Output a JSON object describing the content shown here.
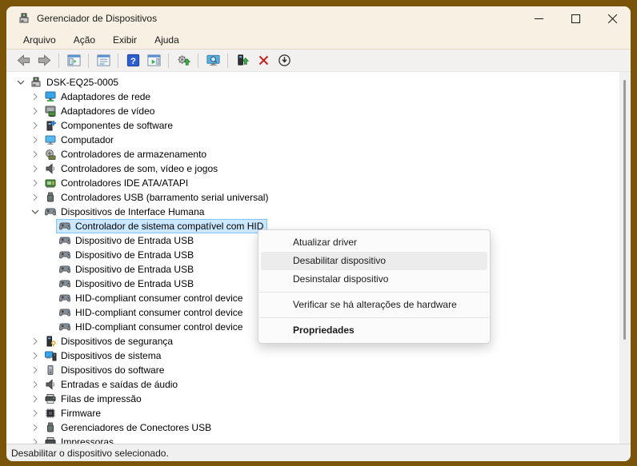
{
  "window": {
    "title": "Gerenciador de Dispositivos",
    "controls": {
      "minimize": "minimize",
      "maximize": "maximize",
      "close": "close"
    }
  },
  "menubar": {
    "items": [
      "Arquivo",
      "Ação",
      "Exibir",
      "Ajuda"
    ]
  },
  "toolbar": {
    "items": [
      {
        "icon": "back-icon"
      },
      {
        "icon": "forward-icon"
      },
      {
        "separator": true
      },
      {
        "icon": "console-tree-icon"
      },
      {
        "separator": true
      },
      {
        "icon": "properties-icon"
      },
      {
        "separator": true
      },
      {
        "icon": "help-icon"
      },
      {
        "icon": "action-pane-icon"
      },
      {
        "separator": true
      },
      {
        "icon": "update-driver-icon"
      },
      {
        "separator": true
      },
      {
        "icon": "scan-hardware-icon"
      },
      {
        "separator": true
      },
      {
        "icon": "driver-up-icon"
      },
      {
        "icon": "uninstall-icon"
      },
      {
        "icon": "disable-device-icon"
      }
    ]
  },
  "tree": {
    "items": [
      {
        "label": "DSK-EQ25-0005",
        "level": 0,
        "expander": "expanded",
        "icon": "computer-root-icon"
      },
      {
        "label": "Adaptadores de rede",
        "level": 1,
        "expander": "collapsed",
        "icon": "network-adapter-icon"
      },
      {
        "label": "Adaptadores de vídeo",
        "level": 1,
        "expander": "collapsed",
        "icon": "display-adapter-icon"
      },
      {
        "label": "Componentes de software",
        "level": 1,
        "expander": "collapsed",
        "icon": "software-component-icon"
      },
      {
        "label": "Computador",
        "level": 1,
        "expander": "collapsed",
        "icon": "computer-icon"
      },
      {
        "label": "Controladores de armazenamento",
        "level": 1,
        "expander": "collapsed",
        "icon": "storage-controller-icon"
      },
      {
        "label": "Controladores de som, vídeo e jogos",
        "level": 1,
        "expander": "collapsed",
        "icon": "sound-controller-icon"
      },
      {
        "label": "Controladores IDE ATA/ATAPI",
        "level": 1,
        "expander": "collapsed",
        "icon": "ide-controller-icon"
      },
      {
        "label": "Controladores USB (barramento serial universal)",
        "level": 1,
        "expander": "collapsed",
        "icon": "usb-controller-icon"
      },
      {
        "label": "Dispositivos de Interface Humana",
        "level": 1,
        "expander": "expanded",
        "icon": "hid-device-icon"
      },
      {
        "label": "Controlador de sistema compatível com HID",
        "level": 2,
        "expander": "none",
        "icon": "hid-device-icon",
        "selected": true
      },
      {
        "label": "Dispositivo de Entrada USB",
        "level": 2,
        "expander": "none",
        "icon": "hid-device-icon"
      },
      {
        "label": "Dispositivo de Entrada USB",
        "level": 2,
        "expander": "none",
        "icon": "hid-device-icon"
      },
      {
        "label": "Dispositivo de Entrada USB",
        "level": 2,
        "expander": "none",
        "icon": "hid-device-icon"
      },
      {
        "label": "Dispositivo de Entrada USB",
        "level": 2,
        "expander": "none",
        "icon": "hid-device-icon"
      },
      {
        "label": "HID-compliant consumer control device",
        "level": 2,
        "expander": "none",
        "icon": "hid-device-icon"
      },
      {
        "label": "HID-compliant consumer control device",
        "level": 2,
        "expander": "none",
        "icon": "hid-device-icon"
      },
      {
        "label": "HID-compliant consumer control device",
        "level": 2,
        "expander": "none",
        "icon": "hid-device-icon"
      },
      {
        "label": "Dispositivos de segurança",
        "level": 1,
        "expander": "collapsed",
        "icon": "security-device-icon"
      },
      {
        "label": "Dispositivos de sistema",
        "level": 1,
        "expander": "collapsed",
        "icon": "system-device-icon"
      },
      {
        "label": "Dispositivos do software",
        "level": 1,
        "expander": "collapsed",
        "icon": "software-device-icon"
      },
      {
        "label": "Entradas e saídas de áudio",
        "level": 1,
        "expander": "collapsed",
        "icon": "audio-io-icon"
      },
      {
        "label": "Filas de impressão",
        "level": 1,
        "expander": "collapsed",
        "icon": "print-queue-icon"
      },
      {
        "label": "Firmware",
        "level": 1,
        "expander": "collapsed",
        "icon": "firmware-icon"
      },
      {
        "label": "Gerenciadores de Conectores USB",
        "level": 1,
        "expander": "collapsed",
        "icon": "usb-connector-icon"
      },
      {
        "label": "Impressoras",
        "level": 1,
        "expander": "collapsed",
        "icon": "printer-icon"
      }
    ]
  },
  "context_menu": {
    "items": [
      {
        "label": "Atualizar driver"
      },
      {
        "label": "Desabilitar dispositivo",
        "highlighted": true
      },
      {
        "label": "Desinstalar dispositivo"
      },
      {
        "separator": true
      },
      {
        "label": "Verificar se há alterações de hardware"
      },
      {
        "separator": true
      },
      {
        "label": "Propriedades",
        "bold": true
      }
    ]
  },
  "statusbar": {
    "text": "Desabilitar o dispositivo selecionado."
  },
  "colors": {
    "frame": "#7a5509",
    "titlebar_bg": "#f8f1e3",
    "toolbar_bg": "#f2f1f0",
    "selection_bg": "#cce8ff",
    "selection_border": "#84c5f5",
    "menu_highlight": "#ececec",
    "uninstall_red": "#c81e1e",
    "accent_green": "#3cb54a",
    "help_blue": "#2d5fd3"
  }
}
